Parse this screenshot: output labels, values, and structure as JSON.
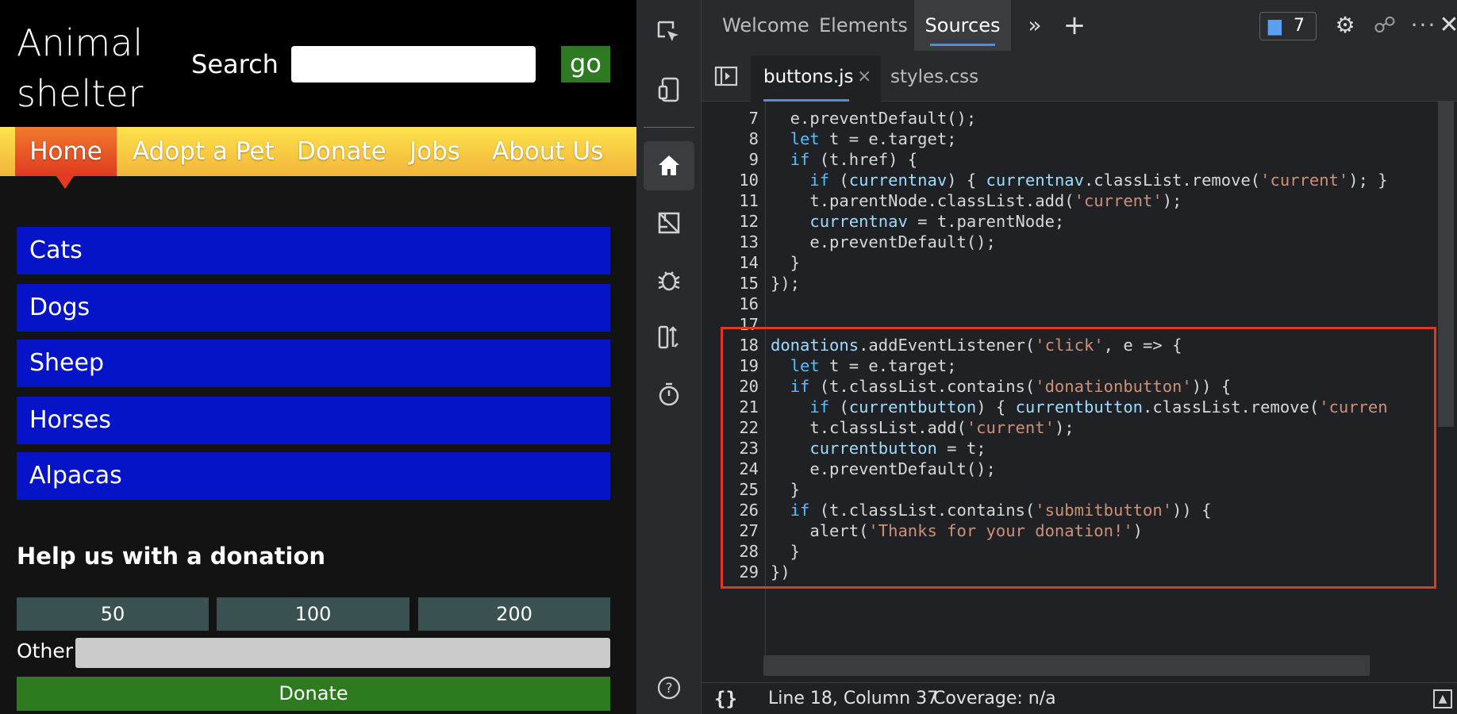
{
  "site": {
    "title": "Animal shelter",
    "search_label": "Search",
    "go_label": "go",
    "nav": [
      "Home",
      "Adopt a Pet",
      "Donate",
      "Jobs",
      "About Us"
    ],
    "animals": [
      "Cats",
      "Dogs",
      "Sheep",
      "Horses",
      "Alpacas"
    ],
    "donation_title": "Help us with a donation",
    "amounts": [
      "50",
      "100",
      "200"
    ],
    "other_label": "Other",
    "donate_label": "Donate"
  },
  "devtools": {
    "tabs": [
      "Welcome",
      "Elements",
      "Sources"
    ],
    "active_tab": "Sources",
    "more_tabs_icon": "chevron-double-right-icon",
    "add_tab_icon": "plus-icon",
    "issues_count": "7",
    "files": {
      "active": "buttons.js",
      "close_glyph": "×",
      "other": "styles.css"
    },
    "status": {
      "pretty_print": "{}",
      "cursor": "Line 18, Column 37",
      "coverage": "Coverage: n/a"
    },
    "highlight_color": "#dc3b21",
    "accent_color": "#4a8fe6"
  },
  "code": [
    {
      "n": "7",
      "segs": [
        [
          "",
          "  e.preventDefault();"
        ]
      ]
    },
    {
      "n": "8",
      "segs": [
        [
          "",
          "  "
        ],
        [
          "kw",
          "let"
        ],
        [
          "",
          " t = e.target;"
        ]
      ]
    },
    {
      "n": "9",
      "segs": [
        [
          "",
          "  "
        ],
        [
          "kw",
          "if"
        ],
        [
          "",
          " (t.href) {"
        ]
      ]
    },
    {
      "n": "10",
      "segs": [
        [
          "",
          "    "
        ],
        [
          "kw",
          "if"
        ],
        [
          "",
          " ("
        ],
        [
          "ident",
          "currentnav"
        ],
        [
          "",
          ") { "
        ],
        [
          "ident",
          "currentnav"
        ],
        [
          "",
          ".classList.remove("
        ],
        [
          "str",
          "'current'"
        ],
        [
          "",
          "); }"
        ]
      ]
    },
    {
      "n": "11",
      "segs": [
        [
          "",
          "    t.parentNode.classList.add("
        ],
        [
          "str",
          "'current'"
        ],
        [
          "",
          ");"
        ]
      ]
    },
    {
      "n": "12",
      "segs": [
        [
          "",
          "    "
        ],
        [
          "ident",
          "currentnav"
        ],
        [
          "",
          " = t.parentNode;"
        ]
      ]
    },
    {
      "n": "13",
      "segs": [
        [
          "",
          "    e.preventDefault();"
        ]
      ]
    },
    {
      "n": "14",
      "segs": [
        [
          "",
          "  }"
        ]
      ]
    },
    {
      "n": "15",
      "segs": [
        [
          "",
          "});"
        ]
      ]
    },
    {
      "n": "16",
      "segs": [
        [
          "",
          ""
        ]
      ]
    },
    {
      "n": "17",
      "segs": [
        [
          "",
          ""
        ]
      ]
    },
    {
      "n": "18",
      "segs": [
        [
          "ident",
          "donations"
        ],
        [
          "",
          ".addEventListener("
        ],
        [
          "str",
          "'click'"
        ],
        [
          "",
          ", e => {"
        ]
      ]
    },
    {
      "n": "19",
      "segs": [
        [
          "",
          "  "
        ],
        [
          "kw",
          "let"
        ],
        [
          "",
          " t = e.target;"
        ]
      ]
    },
    {
      "n": "20",
      "segs": [
        [
          "",
          "  "
        ],
        [
          "kw",
          "if"
        ],
        [
          "",
          " (t.classList.contains("
        ],
        [
          "str",
          "'donationbutton'"
        ],
        [
          "",
          ")) {"
        ]
      ]
    },
    {
      "n": "21",
      "segs": [
        [
          "",
          "    "
        ],
        [
          "kw",
          "if"
        ],
        [
          "",
          " ("
        ],
        [
          "ident",
          "currentbutton"
        ],
        [
          "",
          ") { "
        ],
        [
          "ident",
          "currentbutton"
        ],
        [
          "",
          ".classList.remove("
        ],
        [
          "str",
          "'curren"
        ]
      ]
    },
    {
      "n": "22",
      "segs": [
        [
          "",
          "    t.classList.add("
        ],
        [
          "str",
          "'current'"
        ],
        [
          "",
          ");"
        ]
      ]
    },
    {
      "n": "23",
      "segs": [
        [
          "",
          "    "
        ],
        [
          "ident",
          "currentbutton"
        ],
        [
          "",
          " = t;"
        ]
      ]
    },
    {
      "n": "24",
      "segs": [
        [
          "",
          "    e.preventDefault();"
        ]
      ]
    },
    {
      "n": "25",
      "segs": [
        [
          "",
          "  }"
        ]
      ]
    },
    {
      "n": "26",
      "segs": [
        [
          "",
          "  "
        ],
        [
          "kw",
          "if"
        ],
        [
          "",
          " (t.classList.contains("
        ],
        [
          "str",
          "'submitbutton'"
        ],
        [
          "",
          ")) {"
        ]
      ]
    },
    {
      "n": "27",
      "segs": [
        [
          "",
          "    alert("
        ],
        [
          "str",
          "'Thanks for your donation!'"
        ],
        [
          "",
          ")"
        ]
      ]
    },
    {
      "n": "28",
      "segs": [
        [
          "",
          "  }"
        ]
      ]
    },
    {
      "n": "29",
      "segs": [
        [
          "",
          "})"
        ]
      ]
    }
  ]
}
